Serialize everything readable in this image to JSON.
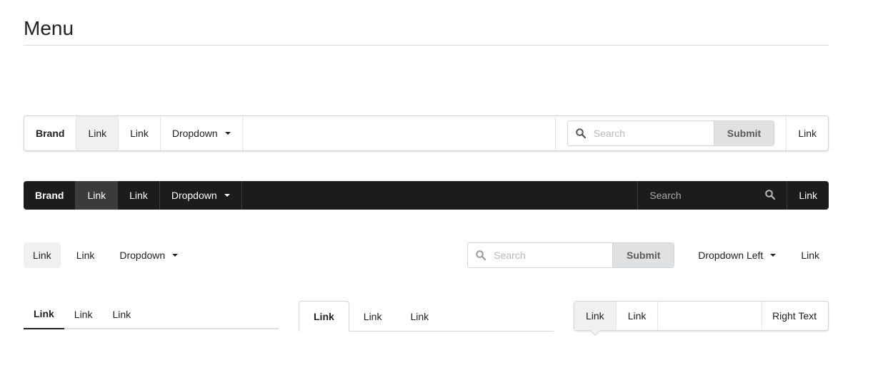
{
  "page": {
    "title": "Menu"
  },
  "menu1": {
    "brand": "Brand",
    "link1": "Link",
    "link2": "Link",
    "dropdown": "Dropdown",
    "search_placeholder": "Search",
    "submit": "Submit",
    "right_link": "Link"
  },
  "menu2": {
    "brand": "Brand",
    "link1": "Link",
    "link2": "Link",
    "dropdown": "Dropdown",
    "search_placeholder": "Search",
    "right_link": "Link"
  },
  "menu3": {
    "link1": "Link",
    "link2": "Link",
    "dropdown": "Dropdown",
    "search_placeholder": "Search",
    "submit": "Submit",
    "dropdown_left": "Dropdown Left",
    "right_link": "Link"
  },
  "tabs_underline": {
    "items": [
      "Link",
      "Link",
      "Link"
    ]
  },
  "tabs_boxed": {
    "items": [
      "Link",
      "Link",
      "Link"
    ]
  },
  "pointing_menu": {
    "items": [
      "Link",
      "Link"
    ],
    "right_text": "Right Text"
  },
  "icons": {
    "search": "search-icon",
    "dropdown": "caret-down-icon"
  },
  "colors": {
    "inverted_bg": "#1b1c1d",
    "active_bg": "#f0f0f0",
    "submit_bg": "#e0e1e2"
  }
}
